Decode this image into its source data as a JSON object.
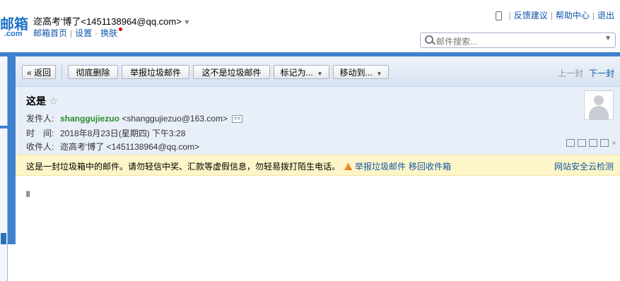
{
  "brand": {
    "logo_text": "邮箱",
    "logo_suffix": ".com",
    "logo_color": "#1d72c6"
  },
  "account": {
    "display": "迩高考'博了<1451138964@qq.com>",
    "caret": "▼"
  },
  "top_links": {
    "home": "邮箱首页",
    "settings": "设置",
    "skin": "换肤"
  },
  "right_links": {
    "feedback": "反馈建议",
    "help": "帮助中心",
    "logout": "退出"
  },
  "search": {
    "placeholder": "邮件搜索..."
  },
  "toolbar": {
    "back": "« 返回",
    "delete_forever": "彻底删除",
    "report_spam": "举报垃圾邮件",
    "not_spam": "这不是垃圾邮件",
    "mark_as": "标记为...",
    "move_to": "移动到...",
    "prev": "上一封",
    "next": "下一封"
  },
  "mail": {
    "subject": "这是",
    "star": "☆",
    "from_label": "发件人:",
    "from_name": "shanggujiezuo",
    "from_addr": "<shanggujiezuo@163.com>",
    "time_label": "时　间:",
    "time_value": "2018年8月23日(星期四) 下午3:28",
    "to_label": "收件人:",
    "to_value": "迩高考'博了 <1451138964@qq.com>",
    "body": "ll"
  },
  "warning": {
    "text": "这是一封垃圾箱中的邮件。请勿轻信中奖、汇款等虚假信息，勿轻易拨打陌生电话。",
    "report_link": "举报垃圾邮件",
    "move_link": "移回收件箱",
    "cloud_check": "网站安全云检测"
  },
  "colors": {
    "accent": "#3f82d0",
    "link": "#1155a7",
    "sender": "#2e8b2e",
    "warning_bg": "#fdf6c8"
  }
}
